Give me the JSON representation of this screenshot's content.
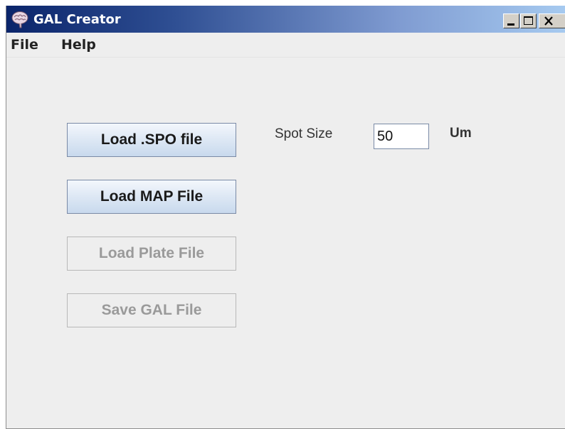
{
  "window": {
    "title": "GAL Creator",
    "icon": "brain-icon",
    "controls": {
      "minimize": "minimize-icon",
      "maximize": "maximize-icon",
      "close": "close-icon"
    }
  },
  "menubar": {
    "items": [
      {
        "label": "File"
      },
      {
        "label": "Help"
      }
    ]
  },
  "buttons": {
    "load_spo": {
      "label": "Load .SPO file",
      "enabled": true
    },
    "load_map": {
      "label": "Load MAP File",
      "enabled": true
    },
    "load_plate": {
      "label": "Load Plate File",
      "enabled": false
    },
    "save_gal": {
      "label": "Save GAL File",
      "enabled": false
    }
  },
  "spot_size": {
    "label": "Spot Size",
    "value": "50",
    "unit": "Um"
  },
  "colors": {
    "titlebar_start": "#0a246a",
    "titlebar_end": "#a6caf0",
    "window_bg": "#eeeeee",
    "button_border": "#7a8aa6"
  }
}
